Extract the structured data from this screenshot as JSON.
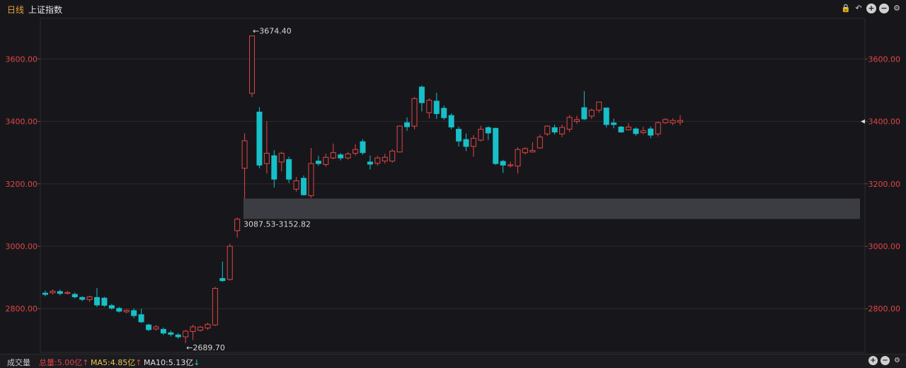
{
  "header": {
    "period_tab": "日线",
    "index_name": "上证指数",
    "icons": [
      "lock-icon",
      "undo-icon",
      "zoom-in-icon",
      "zoom-out-icon",
      "gear-icon"
    ]
  },
  "colors": {
    "up": "#e04545",
    "down": "#17c0c8",
    "axis_text": "#e04545",
    "zone": "#4a4a52",
    "grid": "#2a2a2e"
  },
  "chart_data": {
    "type": "candlestick",
    "ylim": [
      2660,
      3730
    ],
    "yticks": [
      "2800.00",
      "3000.00",
      "3200.00",
      "3400.00",
      "3600.00"
    ],
    "yticks_values": [
      2800,
      3000,
      3200,
      3400,
      3600
    ],
    "last_price": 3400,
    "annotations": {
      "high_label": "←3674.40",
      "high_value": 3674.4,
      "low_label": "←2689.70",
      "low_value": 2689.7,
      "zone_label": "3087.53-3152.82",
      "zone_low": 3087.53,
      "zone_high": 3152.82
    },
    "candles": [
      [
        2850,
        2846,
        2858,
        2840
      ],
      [
        2851,
        2856,
        2862,
        2846
      ],
      [
        2855,
        2849,
        2861,
        2843
      ],
      [
        2849,
        2852,
        2857,
        2846
      ],
      [
        2846,
        2838,
        2852,
        2833
      ],
      [
        2836,
        2830,
        2840,
        2824
      ],
      [
        2829,
        2838,
        2842,
        2822
      ],
      [
        2836,
        2812,
        2866,
        2806
      ],
      [
        2834,
        2811,
        2838,
        2806
      ],
      [
        2810,
        2802,
        2815,
        2797
      ],
      [
        2801,
        2792,
        2806,
        2788
      ],
      [
        2790,
        2795,
        2799,
        2785
      ],
      [
        2794,
        2778,
        2801,
        2770
      ],
      [
        2781,
        2758,
        2800,
        2754
      ],
      [
        2748,
        2733,
        2752,
        2728
      ],
      [
        2735,
        2742,
        2748,
        2730
      ],
      [
        2734,
        2722,
        2740,
        2716
      ],
      [
        2723,
        2718,
        2730,
        2711
      ],
      [
        2716,
        2710,
        2722,
        2704
      ],
      [
        2710,
        2728,
        2732,
        2690
      ],
      [
        2727,
        2742,
        2749,
        2700
      ],
      [
        2731,
        2741,
        2745,
        2727
      ],
      [
        2738,
        2750,
        2755,
        2732
      ],
      [
        2748,
        2865,
        2870,
        2745
      ],
      [
        2897,
        2890,
        2951,
        2886
      ],
      [
        2894,
        3000,
        3008,
        2890
      ],
      [
        3050,
        3087,
        3092,
        3028
      ],
      [
        3250,
        3338,
        3362,
        3152
      ],
      [
        3490,
        3674,
        3674,
        3478
      ],
      [
        3430,
        3260,
        3446,
        3250
      ],
      [
        3265,
        3298,
        3400,
        3233
      ],
      [
        3290,
        3215,
        3308,
        3188
      ],
      [
        3270,
        3298,
        3303,
        3240
      ],
      [
        3278,
        3215,
        3287,
        3203
      ],
      [
        3183,
        3210,
        3222,
        3175
      ],
      [
        3218,
        3165,
        3227,
        3162
      ],
      [
        3162,
        3265,
        3315,
        3155
      ],
      [
        3273,
        3265,
        3290,
        3258
      ],
      [
        3262,
        3285,
        3297,
        3255
      ],
      [
        3283,
        3300,
        3329,
        3279
      ],
      [
        3293,
        3283,
        3299,
        3275
      ],
      [
        3283,
        3296,
        3302,
        3278
      ],
      [
        3298,
        3310,
        3327,
        3290
      ],
      [
        3335,
        3300,
        3343,
        3293
      ],
      [
        3270,
        3263,
        3291,
        3246
      ],
      [
        3266,
        3283,
        3290,
        3258
      ],
      [
        3273,
        3285,
        3296,
        3265
      ],
      [
        3273,
        3305,
        3311,
        3268
      ],
      [
        3302,
        3385,
        3387,
        3302
      ],
      [
        3396,
        3383,
        3413,
        3370
      ],
      [
        3385,
        3473,
        3478,
        3375
      ],
      [
        3510,
        3460,
        3515,
        3432
      ],
      [
        3428,
        3468,
        3474,
        3410
      ],
      [
        3465,
        3425,
        3492,
        3408
      ],
      [
        3442,
        3412,
        3451,
        3405
      ],
      [
        3419,
        3382,
        3426,
        3375
      ],
      [
        3375,
        3337,
        3383,
        3320
      ],
      [
        3342,
        3320,
        3361,
        3305
      ],
      [
        3320,
        3346,
        3356,
        3287
      ],
      [
        3340,
        3375,
        3386,
        3336
      ],
      [
        3380,
        3363,
        3385,
        3340
      ],
      [
        3378,
        3265,
        3380,
        3260
      ],
      [
        3272,
        3260,
        3277,
        3235
      ],
      [
        3258,
        3261,
        3271,
        3252
      ],
      [
        3257,
        3310,
        3317,
        3233
      ],
      [
        3300,
        3313,
        3317,
        3294
      ],
      [
        3302,
        3307,
        3333,
        3302
      ],
      [
        3315,
        3350,
        3358,
        3313
      ],
      [
        3360,
        3385,
        3388,
        3353
      ],
      [
        3380,
        3366,
        3390,
        3358
      ],
      [
        3360,
        3381,
        3390,
        3350
      ],
      [
        3375,
        3413,
        3420,
        3366
      ],
      [
        3400,
        3406,
        3418,
        3392
      ],
      [
        3444,
        3408,
        3497,
        3404
      ],
      [
        3417,
        3436,
        3441,
        3408
      ],
      [
        3436,
        3462,
        3462,
        3428
      ],
      [
        3443,
        3390,
        3444,
        3381
      ],
      [
        3395,
        3390,
        3409,
        3378
      ],
      [
        3382,
        3366,
        3385,
        3364
      ],
      [
        3373,
        3382,
        3394,
        3371
      ],
      [
        3376,
        3361,
        3381,
        3354
      ],
      [
        3364,
        3370,
        3383,
        3359
      ],
      [
        3376,
        3356,
        3384,
        3346
      ],
      [
        3360,
        3396,
        3400,
        3352
      ],
      [
        3396,
        3406,
        3411,
        3392
      ],
      [
        3395,
        3403,
        3410,
        3388
      ],
      [
        3398,
        3403,
        3420,
        3388
      ]
    ]
  },
  "volume_bar": {
    "title": "成交量",
    "total": "总量:5.00亿",
    "ma5": "MA5:4.85亿",
    "ma10": "MA10:5.13亿",
    "icons": [
      "zoom-in-icon",
      "zoom-out-icon",
      "gear-icon"
    ]
  }
}
